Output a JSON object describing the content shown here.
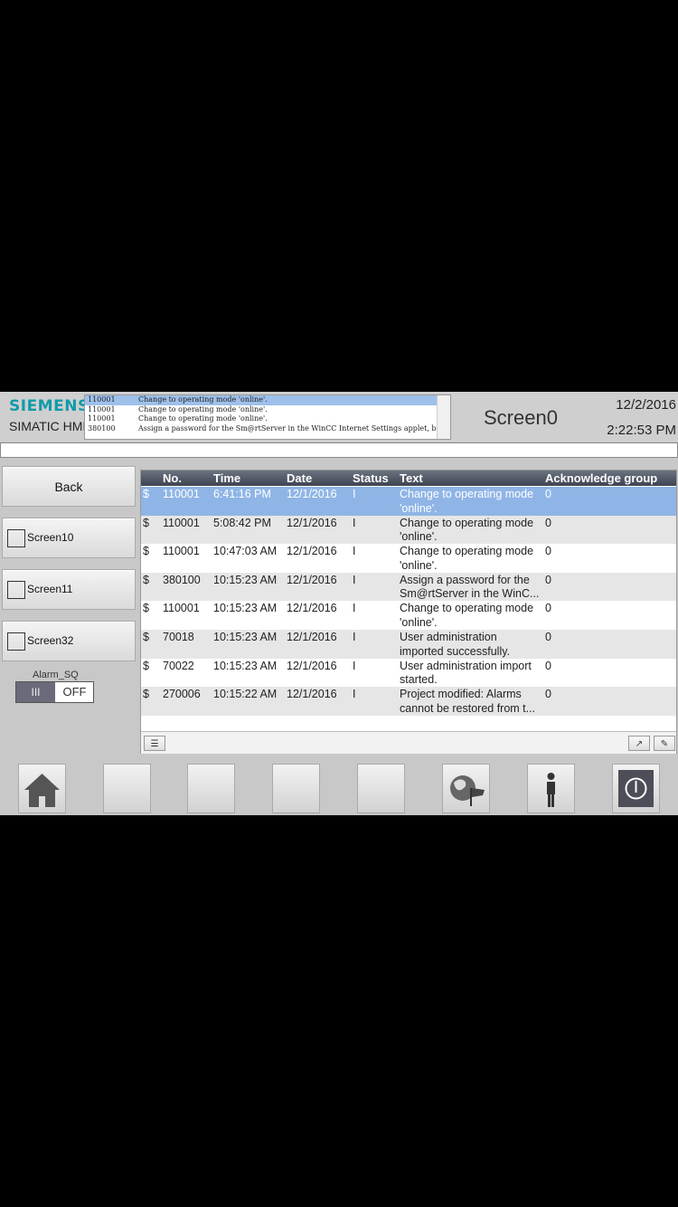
{
  "header": {
    "brand": "SIEMENS",
    "brand_sub": "SIMATIC HMI",
    "screen_title": "Screen0",
    "date": "12/2/2016",
    "time": "2:22:53 PM",
    "mini_alarms": [
      {
        "no": "110001",
        "text": "Change to operating mode 'online'."
      },
      {
        "no": "110001",
        "text": "Change to operating mode 'online'."
      },
      {
        "no": "110001",
        "text": "Change to operating mode 'online'."
      },
      {
        "no": "380100",
        "text": "Assign a password for the Sm@rtServer in the WinCC Internet Settings applet, bec..."
      }
    ]
  },
  "nav": {
    "back": "Back",
    "screens": [
      "Screen10",
      "Screen11",
      "Screen32"
    ],
    "toggle_label": "Alarm_SQ",
    "toggle_on": "III",
    "toggle_off": "OFF"
  },
  "alarm_table": {
    "columns": [
      "No.",
      "Time",
      "Date",
      "Status",
      "Text",
      "Acknowledge group"
    ],
    "rows": [
      {
        "flag": "$",
        "no": "110001",
        "time": "6:41:16 PM",
        "date": "12/1/2016",
        "status": "I",
        "text": "Change to operating mode 'online'.",
        "ack": "0"
      },
      {
        "flag": "$",
        "no": "110001",
        "time": "5:08:42 PM",
        "date": "12/1/2016",
        "status": "I",
        "text": "Change to operating mode 'online'.",
        "ack": "0"
      },
      {
        "flag": "$",
        "no": "110001",
        "time": "10:47:03 AM",
        "date": "12/1/2016",
        "status": "I",
        "text": "Change to operating mode 'online'.",
        "ack": "0"
      },
      {
        "flag": "$",
        "no": "380100",
        "time": "10:15:23 AM",
        "date": "12/1/2016",
        "status": "I",
        "text": "Assign a password for the Sm@rtServer in the WinC...",
        "ack": "0"
      },
      {
        "flag": "$",
        "no": "110001",
        "time": "10:15:23 AM",
        "date": "12/1/2016",
        "status": "I",
        "text": "Change to operating mode 'online'.",
        "ack": "0"
      },
      {
        "flag": "$",
        "no": "70018",
        "time": "10:15:23 AM",
        "date": "12/1/2016",
        "status": "I",
        "text": "User administration imported successfully.",
        "ack": "0"
      },
      {
        "flag": "$",
        "no": "70022",
        "time": "10:15:23 AM",
        "date": "12/1/2016",
        "status": "I",
        "text": "User administration import started.",
        "ack": "0"
      },
      {
        "flag": "$",
        "no": "270006",
        "time": "10:15:22 AM",
        "date": "12/1/2016",
        "status": "I",
        "text": "Project modified: Alarms cannot be restored from t...",
        "ack": "0"
      }
    ]
  },
  "function_keys": [
    {
      "icon": "home-icon"
    },
    {
      "icon": ""
    },
    {
      "icon": ""
    },
    {
      "icon": ""
    },
    {
      "icon": ""
    },
    {
      "icon": "globe-flag-icon"
    },
    {
      "icon": "user-icon"
    },
    {
      "icon": "power-icon"
    }
  ],
  "colors": {
    "brand": "#119ba9",
    "selected_row": "#8fb5e6",
    "header_bg": "#3e4452"
  }
}
